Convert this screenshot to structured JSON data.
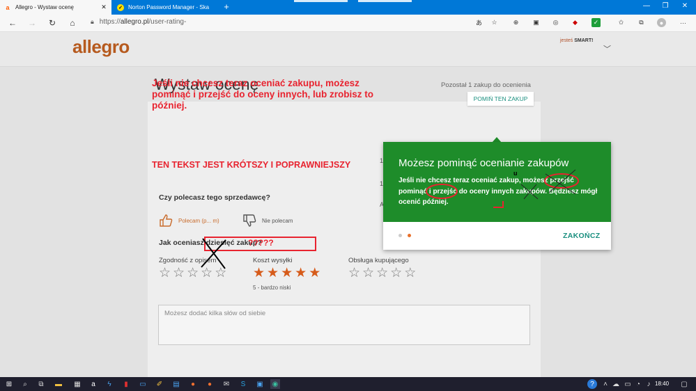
{
  "browser": {
    "tabs": [
      {
        "title": "Allegro - Wystaw ocenę",
        "active": true
      },
      {
        "title": "Norton Password Manager - Ska",
        "active": false
      }
    ],
    "new_tab": "+",
    "url_prefix": "https://",
    "url_main": "allegro.pl",
    "url_path": "/user-rating-"
  },
  "header": {
    "logo": "allegro",
    "smart_prefix": "jesteś ",
    "smart_label": "SMART!"
  },
  "page": {
    "title": "Wystaw ocenę",
    "remaining": "Pozostał 1 zakup do ocenienia",
    "skip_button": "POMIŃ TEN ZAKUP",
    "row_mark_1": "1",
    "row_mark_2": "1",
    "row_mark_3": "A",
    "recommend_question": "Czy polecasz tego sprzedawcę?",
    "recommend_yes": "Polecam (p... m)",
    "recommend_no": "Nie polecam",
    "rate_question": "Jak oceniasz dziesięć zakup?",
    "qmarks": "?????",
    "ratings": [
      {
        "label": "Zgodność z opisem",
        "stars": 0,
        "sub": ""
      },
      {
        "label": "Koszt wysyłki",
        "stars": 5,
        "sub": "5 - bardzo niski"
      },
      {
        "label": "Obsługa kupującego",
        "stars": 0,
        "sub": ""
      }
    ],
    "comment_placeholder": "Możesz dodać kilka słów od siebie"
  },
  "annotations": {
    "text1": "Jeśli nie chcesz teraz oceniać zakupu, możesz pominąć i przejść do oceny innych, lub zrobisz to później.",
    "text2": "TEN TEKST JEST KRÓTSZY I POPRAWNIEJSZY",
    "edit_mark": "u"
  },
  "popup": {
    "title": "Możesz pominąć ocenianie zakupów",
    "body": "Jeśli nie chcesz teraz oceniać zakup, możesz przejść pominąć i przejść do oceny innych zakupów. Będziesz mógł ocenić później.",
    "finish": "ZAKOŃCZ"
  },
  "taskbar": {
    "time": "18:40"
  },
  "colors": {
    "brand": "#b65a1e",
    "popup_green": "#1e8c2a",
    "accent_teal": "#1a8f7f",
    "annotation_red": "#e8232f",
    "star_on": "#d65b1a"
  }
}
